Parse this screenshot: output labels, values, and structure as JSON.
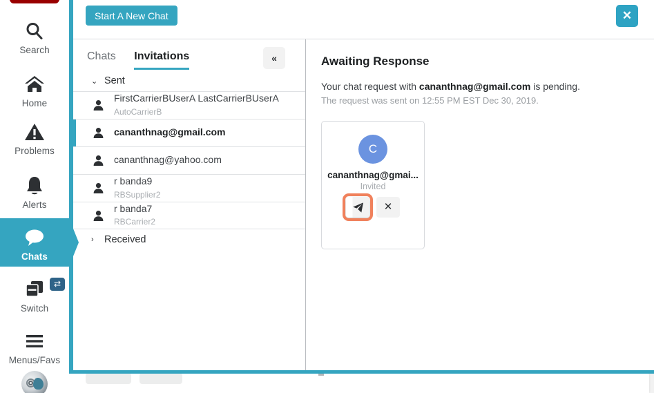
{
  "rail": {
    "items": [
      {
        "label": "Search",
        "icon": "search-icon",
        "active": false
      },
      {
        "label": "Home",
        "icon": "home-icon",
        "active": false
      },
      {
        "label": "Problems",
        "icon": "warning-triangle-icon",
        "active": false
      },
      {
        "label": "Alerts",
        "icon": "bell-icon",
        "active": false
      },
      {
        "label": "Chats",
        "icon": "chat-bubble-icon",
        "active": true
      },
      {
        "label": "Switch",
        "icon": "windows-stack-icon",
        "active": false
      },
      {
        "label": "Menus/Favs",
        "icon": "hamburger-icon",
        "active": false
      }
    ],
    "switch_badge_icon": "swap-arrows-icon",
    "avatar_icon": "user-avatar-icon"
  },
  "panel": {
    "new_chat_label": "Start A New Chat",
    "close_icon": "close-icon",
    "close_label": "✕",
    "collapse_icon": "double-chevron-left-icon",
    "collapse_label": "«"
  },
  "tabs": [
    {
      "label": "Chats",
      "active": false
    },
    {
      "label": "Invitations",
      "active": true
    }
  ],
  "groups": [
    {
      "label": "Sent",
      "expanded": true,
      "caret": "⌄"
    },
    {
      "label": "Received",
      "expanded": false,
      "caret": "›"
    }
  ],
  "invitations": [
    {
      "name": "FirstCarrierBUserA LastCarrierBUserA",
      "sub": "AutoCarrierB",
      "selected": false
    },
    {
      "name": "cananthnag@gmail.com",
      "sub": "",
      "selected": true
    },
    {
      "name": "cananthnag@yahoo.com",
      "sub": "",
      "selected": false
    },
    {
      "name": "r banda9",
      "sub": "RBSupplier2",
      "selected": false
    },
    {
      "name": "r banda7",
      "sub": "RBCarrier2",
      "selected": false
    }
  ],
  "detail": {
    "title": "Awaiting Response",
    "request_prefix": "Your chat request with ",
    "request_contact": "cananthnag@gmail.com",
    "request_suffix": " is pending.",
    "sent_on": "The request was sent on 12:55 PM EST Dec 30, 2019.",
    "card": {
      "initial": "C",
      "name": "cananthnag@gmai...",
      "status": "Invited",
      "send_icon": "send-paper-plane-icon",
      "cancel_icon": "close-icon",
      "cancel_label": "✕"
    }
  },
  "colors": {
    "accent_teal": "#35a5c0",
    "avatar_blue": "#6b93e0",
    "highlight_orange": "#f0815c",
    "top_red": "#990000",
    "badge_blue": "#2f6388"
  }
}
